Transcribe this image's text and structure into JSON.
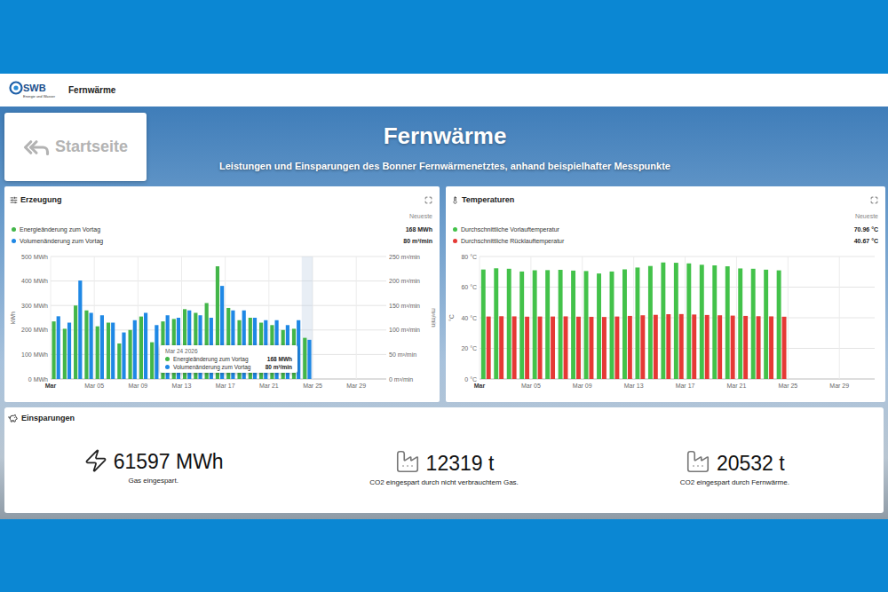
{
  "header": {
    "logo": "SWB",
    "logo_subtitle": "Energie und Wasser",
    "title": "Fernwärme"
  },
  "home_button": {
    "label": "Startseite"
  },
  "hero": {
    "title": "Fernwärme",
    "subtitle": "Leistungen und Einsparungen des Bonner Fernwärmenetztes, anhand beispielhafter Messpunkte"
  },
  "production": {
    "title": "Erzeugung",
    "latest_label": "Neueste",
    "series": [
      {
        "label": "Energieänderung zum Vortag",
        "latest": "168 MWh",
        "color": "#43b649",
        "axis": "left",
        "values": [
          235,
          205,
          300,
          280,
          215,
          230,
          145,
          200,
          255,
          150,
          235,
          245,
          285,
          270,
          310,
          460,
          290,
          240,
          250,
          230,
          220,
          200,
          205,
          168
        ]
      },
      {
        "label": "Volumenänderung zum Vortag",
        "latest": "80 m³/min",
        "color": "#1f88e5",
        "axis": "right",
        "values": [
          128,
          115,
          201,
          135,
          130,
          115,
          95,
          120,
          135,
          110,
          130,
          125,
          140,
          130,
          125,
          190,
          140,
          140,
          125,
          120,
          120,
          110,
          120,
          80
        ]
      }
    ],
    "y_axis_left": {
      "title": "kWh",
      "range": [
        0,
        500
      ],
      "ticks": [
        "0 MWh",
        "100 MWh",
        "200 MWh",
        "300 MWh",
        "400 MWh",
        "500 MWh"
      ]
    },
    "y_axis_right": {
      "title": "m³/min",
      "range": [
        0,
        250
      ],
      "ticks": [
        "0 m³/min",
        "50 m³/min",
        "100 m³/min",
        "150 m³/min",
        "200 m³/min",
        "250 m³/min"
      ]
    },
    "x_ticks": [
      "Mar",
      "Mar 05",
      "Mar 09",
      "Mar 13",
      "Mar 17",
      "Mar 21",
      "Mar 25",
      "Mar 29"
    ],
    "hovered_index": 23,
    "tooltip": {
      "date": "Mar 24 2026",
      "rows": [
        {
          "label": "Energieänderung zum Vortag",
          "value": "168 MWh",
          "color": "#43b649"
        },
        {
          "label": "Volumenänderung zum Vortag",
          "value": "80 m³/min",
          "color": "#1f88e5"
        }
      ]
    }
  },
  "temperatures": {
    "title": "Temperaturen",
    "latest_label": "Neueste",
    "series": [
      {
        "label": "Durchschnittliche Vorlauftemperatur",
        "latest": "70.96 °C",
        "color": "#43c24a",
        "axis": "left",
        "values": [
          71.5,
          72.3,
          72.0,
          70.2,
          71.0,
          71.1,
          71.3,
          70.8,
          70.5,
          68.9,
          70.2,
          71.6,
          72.8,
          73.8,
          76.1,
          75.9,
          75.5,
          74.6,
          74.2,
          73.6,
          72.2,
          72.0,
          71.4,
          70.96
        ]
      },
      {
        "label": "Durchschnittliche Rücklauftemperatur",
        "latest": "40.67 °C",
        "color": "#e53935",
        "axis": "left",
        "values": [
          40.8,
          41.0,
          40.9,
          40.7,
          40.8,
          40.8,
          40.9,
          40.7,
          40.6,
          40.5,
          40.8,
          41.2,
          41.6,
          41.9,
          42.3,
          42.4,
          42.1,
          41.8,
          41.6,
          41.4,
          41.2,
          41.0,
          40.9,
          40.67
        ]
      }
    ],
    "y_axis_left": {
      "title": "°C",
      "range": [
        0,
        80
      ],
      "ticks": [
        "0 °C",
        "20 °C",
        "40 °C",
        "60 °C",
        "80 °C"
      ]
    },
    "x_ticks": [
      "Mar",
      "Mar 05",
      "Mar 09",
      "Mar 13",
      "Mar 17",
      "Mar 21",
      "Mar 25",
      "Mar 29"
    ]
  },
  "savings": {
    "title": "Einsparungen",
    "items": [
      {
        "kind": "energy",
        "value": "61597 MWh",
        "caption": "Gas eingespart."
      },
      {
        "kind": "co2",
        "value": "12319 t",
        "caption": "CO2 eingespart durch nicht verbrauchtem Gas."
      },
      {
        "kind": "co2",
        "value": "20532 t",
        "caption": "CO2 eingespart durch Fernwärme."
      }
    ]
  }
}
